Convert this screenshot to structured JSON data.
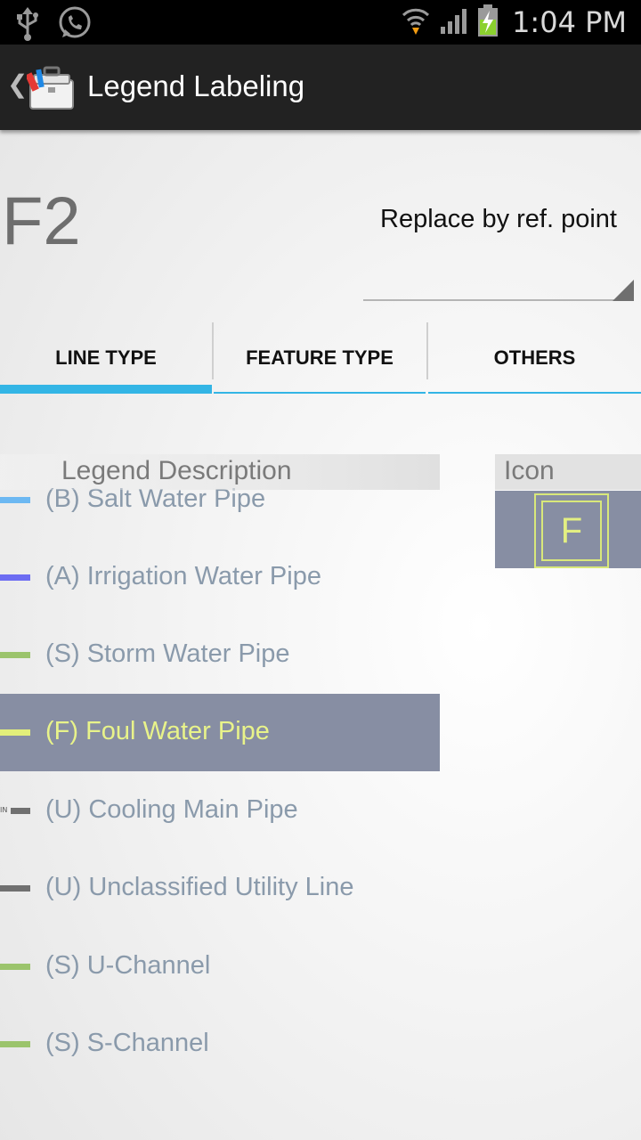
{
  "status_bar": {
    "time": "1:04 PM",
    "icons": [
      "usb-icon",
      "whatsapp-icon",
      "wifi-icon",
      "signal-icon",
      "battery-charging-icon"
    ]
  },
  "action_bar": {
    "title": "Legend Labeling",
    "icon": "toolbox-app-icon"
  },
  "header": {
    "code": "F2",
    "replace_spinner_value": "Replace by ref. point"
  },
  "tabs": [
    {
      "label": "LINE TYPE",
      "selected": true
    },
    {
      "label": "FEATURE TYPE",
      "selected": false
    },
    {
      "label": "OTHERS",
      "selected": false
    }
  ],
  "table": {
    "col_description": "Legend Description",
    "col_icon": "Icon",
    "selected_icon_letter": "F",
    "rows": [
      {
        "label": "(B) Salt Water Pipe",
        "color": "#6cb8f2"
      },
      {
        "label": "(A) Irrigation Water Pipe",
        "color": "#6c6cf2"
      },
      {
        "label": "(S) Storm Water Pipe",
        "color": "#9bc46c"
      },
      {
        "label": "(F) Foul Water Pipe",
        "color": "#e2ef7a",
        "selected": true
      },
      {
        "label": "(U) Cooling Main Pipe",
        "color": "#707070",
        "prefix": "IN"
      },
      {
        "label": "(U) Unclassified Utility Line",
        "color": "#707070"
      },
      {
        "label": "(S) U-Channel",
        "color": "#9bc46c"
      },
      {
        "label": "(S) S-Channel",
        "color": "#9bc46c"
      }
    ]
  },
  "colors": {
    "accent": "#33b5e5",
    "selection": "#878ea3",
    "selected_text": "#e8f38a",
    "action_bar": "#222222"
  }
}
